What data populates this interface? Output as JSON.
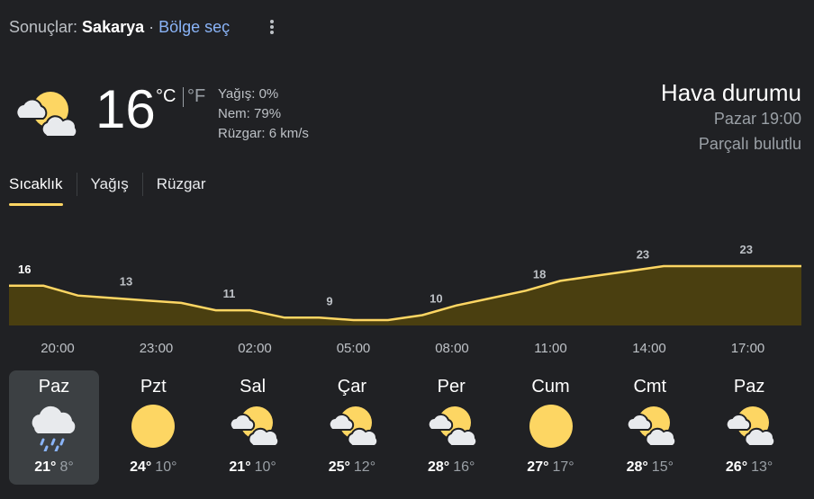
{
  "header": {
    "results_label": "Sonuçlar:",
    "location": "Sakarya",
    "separator": "·",
    "choose_region": "Bölge seç",
    "more_icon": "more-vert-icon"
  },
  "current": {
    "icon": "partly-cloudy-icon",
    "temperature": "16",
    "unit_c": "°C",
    "unit_f": "°F",
    "precipitation": "Yağış: 0%",
    "humidity": "Nem: 79%",
    "wind": "Rüzgar: 6 km/s",
    "title": "Hava durumu",
    "time": "Pazar 19:00",
    "condition": "Parçalı bulutlu"
  },
  "tabs": [
    {
      "label": "Sıcaklık",
      "active": true
    },
    {
      "label": "Yağış",
      "active": false
    },
    {
      "label": "Rüzgar",
      "active": false
    }
  ],
  "chart_data": {
    "type": "area",
    "title": "",
    "xlabel": "",
    "ylabel": "",
    "x": [
      "20:00",
      "21:00",
      "22:00",
      "23:00",
      "00:00",
      "01:00",
      "02:00",
      "03:00",
      "04:00",
      "05:00",
      "06:00",
      "07:00",
      "08:00",
      "09:00",
      "10:00",
      "11:00",
      "12:00",
      "13:00",
      "14:00",
      "15:00",
      "16:00",
      "17:00",
      "18:00",
      "19:00"
    ],
    "values": [
      16,
      16,
      14,
      13.5,
      13,
      12.5,
      11,
      11,
      9.5,
      9.5,
      9,
      9,
      10,
      12,
      13.5,
      15,
      17,
      18,
      19,
      20,
      20,
      20,
      20,
      20
    ],
    "label_indices": [
      0,
      3,
      6,
      9,
      12,
      15,
      18,
      21
    ],
    "labels": [
      "16",
      "13",
      "11",
      "9",
      "10",
      "18",
      "23",
      "23"
    ],
    "hour_ticks": [
      "20:00",
      "23:00",
      "02:00",
      "05:00",
      "08:00",
      "11:00",
      "14:00",
      "17:00"
    ],
    "line_color": "#fdd663",
    "fill_color": "#4a3f10",
    "grid": false,
    "legend": "none"
  },
  "forecast": [
    {
      "day": "Paz",
      "icon": "rain-icon",
      "high": "21°",
      "low": "8°",
      "selected": true
    },
    {
      "day": "Pzt",
      "icon": "sun-icon",
      "high": "24°",
      "low": "10°",
      "selected": false
    },
    {
      "day": "Sal",
      "icon": "partly-cloudy-icon",
      "high": "21°",
      "low": "10°",
      "selected": false
    },
    {
      "day": "Çar",
      "icon": "partly-cloudy-icon",
      "high": "25°",
      "low": "12°",
      "selected": false
    },
    {
      "day": "Per",
      "icon": "partly-cloudy-icon",
      "high": "28°",
      "low": "16°",
      "selected": false
    },
    {
      "day": "Cum",
      "icon": "sun-icon",
      "high": "27°",
      "low": "17°",
      "selected": false
    },
    {
      "day": "Cmt",
      "icon": "partly-cloudy-icon",
      "high": "28°",
      "low": "15°",
      "selected": false
    },
    {
      "day": "Paz",
      "icon": "partly-cloudy-icon",
      "high": "26°",
      "low": "13°",
      "selected": false
    }
  ],
  "colors": {
    "background": "#202124",
    "accent": "#fdd663",
    "link": "#8ab4f8",
    "sun": "#fdd663",
    "cloud": "#e8eaed"
  }
}
